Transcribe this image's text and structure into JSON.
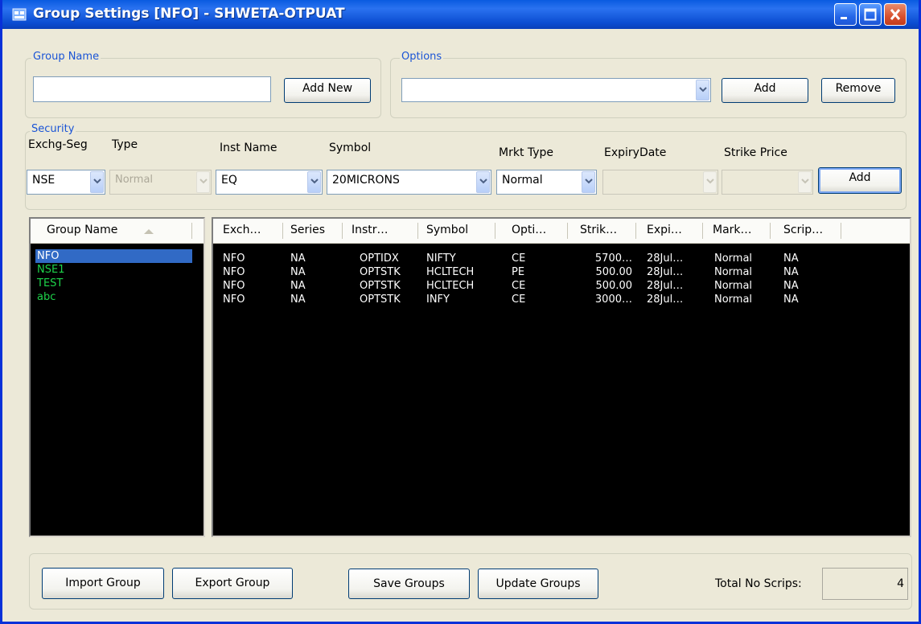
{
  "window": {
    "title": "Group Settings [NFO] - SHWETA-OTPUAT",
    "min_label": "_",
    "max_label": "□",
    "close_label": "X"
  },
  "group_name_box": {
    "legend": "Group Name",
    "input_value": "",
    "add_new_label": "Add New"
  },
  "options_box": {
    "legend": "Options",
    "select_value": "",
    "add_label": "Add",
    "remove_label": "Remove"
  },
  "security_box": {
    "legend": "Security",
    "labels": {
      "exchg_seg": "Exchg-Seg",
      "type": "Type",
      "inst_name": "Inst Name",
      "symbol": "Symbol",
      "mrkt_type": "Mrkt Type",
      "expiry_date": "ExpiryDate",
      "strike_price": "Strike Price"
    },
    "values": {
      "exchg_seg": "NSE",
      "type": "Normal",
      "inst_name": "EQ",
      "symbol": "20MICRONS",
      "mrkt_type": "Normal",
      "expiry_date": "",
      "strike_price": ""
    },
    "add_label": "Add"
  },
  "groups_list": {
    "header": "Group Name",
    "items": [
      {
        "name": "NFO",
        "selected": true
      },
      {
        "name": "NSE1",
        "selected": false
      },
      {
        "name": "TEST",
        "selected": false
      },
      {
        "name": "abc",
        "selected": false
      }
    ]
  },
  "scrips_table": {
    "columns": [
      "Exch…",
      "Series",
      "Instr…",
      "Symbol",
      "Opti…",
      "Strik…",
      "Expi…",
      "Mark…",
      "Scrip…"
    ],
    "rows": [
      [
        "NFO",
        "NA",
        "OPTIDX",
        "NIFTY",
        "CE",
        "5700…",
        "28Jul…",
        "Normal",
        "NA"
      ],
      [
        "NFO",
        "NA",
        "OPTSTK",
        "HCLTECH",
        "PE",
        "500.00",
        "28Jul…",
        "Normal",
        "NA"
      ],
      [
        "NFO",
        "NA",
        "OPTSTK",
        "HCLTECH",
        "CE",
        "500.00",
        "28Jul…",
        "Normal",
        "NA"
      ],
      [
        "NFO",
        "NA",
        "OPTSTK",
        "INFY",
        "CE",
        "3000…",
        "28Jul…",
        "Normal",
        "NA"
      ]
    ]
  },
  "footer": {
    "import_label": "Import Group",
    "export_label": "Export Group",
    "save_label": "Save Groups",
    "update_label": "Update Groups",
    "total_label": "Total No Scrips:",
    "total_value": "4"
  },
  "colors": {
    "title_bar": "#0a5be0",
    "legend_text": "#1a54d6",
    "list_background": "#000000",
    "selected_item": "#316ac5",
    "group_item_text": "#1ed34a",
    "row_text": "#ffffff"
  }
}
